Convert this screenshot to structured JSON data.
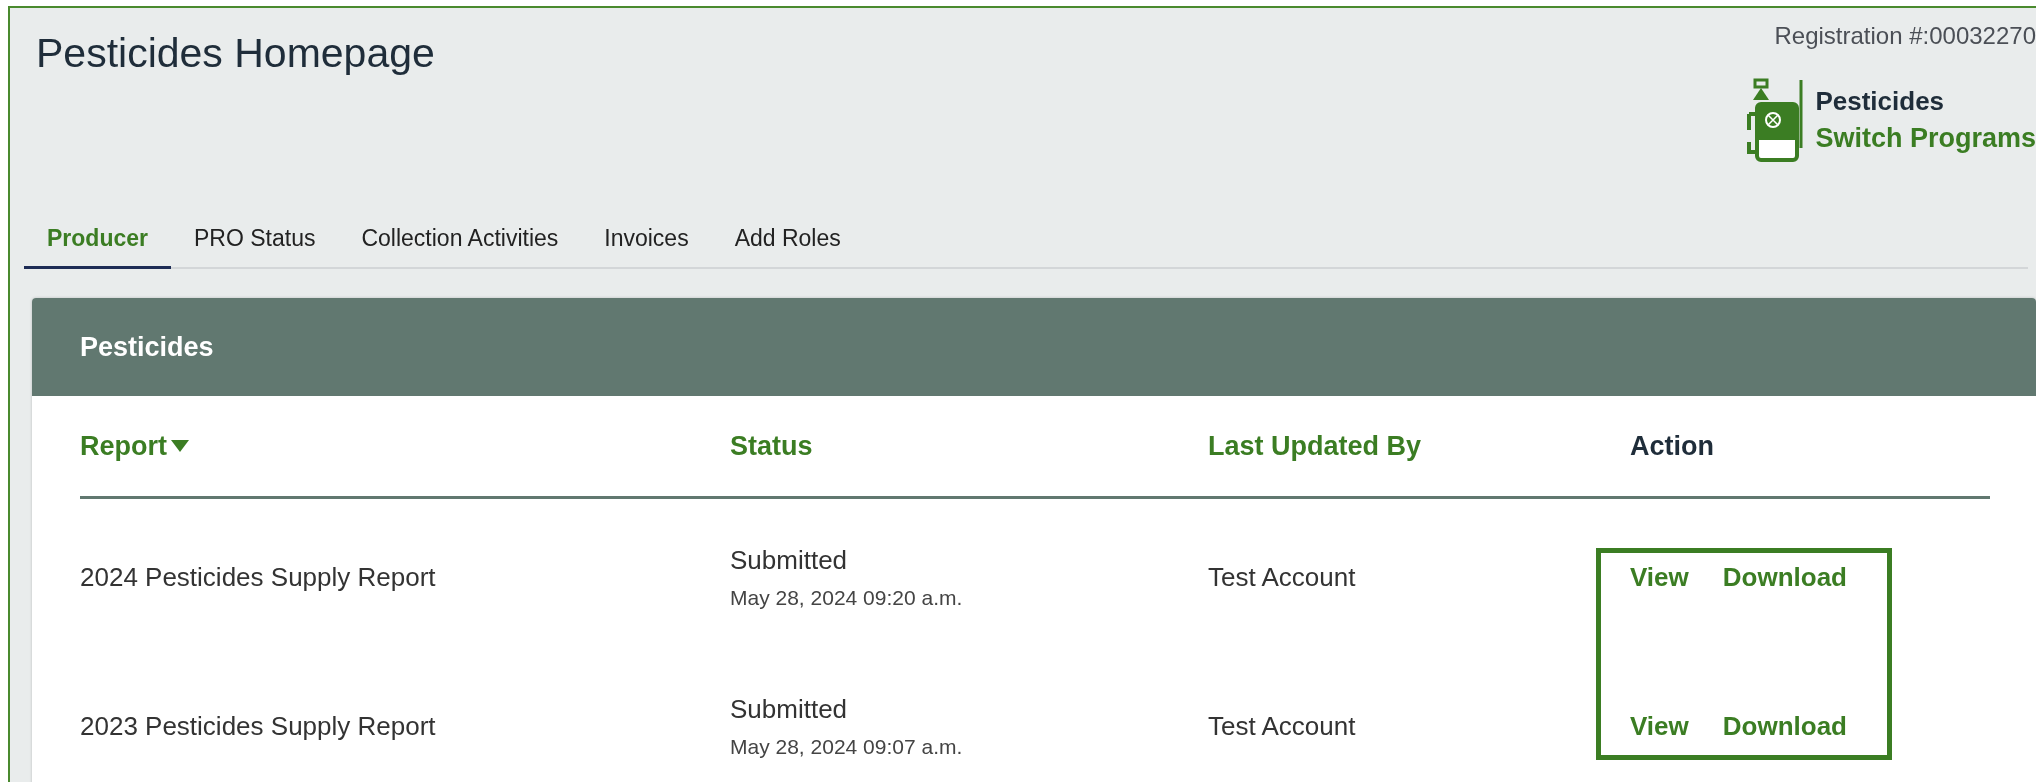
{
  "header": {
    "title": "Pesticides Homepage",
    "registration": "Registration #:00032270",
    "program": {
      "name": "Pesticides",
      "switch_link": "Switch Programs"
    }
  },
  "tabs": [
    {
      "label": "Producer",
      "selected": true
    },
    {
      "label": "PRO Status",
      "selected": false
    },
    {
      "label": "Collection Activities",
      "selected": false
    },
    {
      "label": "Invoices",
      "selected": false
    },
    {
      "label": "Add Roles",
      "selected": false
    }
  ],
  "card": {
    "title": "Pesticides",
    "table": {
      "columns": [
        {
          "label": "Report",
          "sortable": true,
          "sorted": true
        },
        {
          "label": "Status",
          "sortable": true,
          "sorted": false
        },
        {
          "label": "Last Updated By",
          "sortable": true,
          "sorted": false
        },
        {
          "label": "Action",
          "sortable": false,
          "sorted": false
        }
      ],
      "rows": [
        {
          "report": "2024 Pesticides Supply Report",
          "status": "Submitted",
          "date": "May 28, 2024 09:20 a.m.",
          "updated_by": "Test Account",
          "actions": [
            "View",
            "Download"
          ]
        },
        {
          "report": "2023 Pesticides Supply Report",
          "status": "Submitted",
          "date": "May 28, 2024 09:07 a.m.",
          "updated_by": "Test Account",
          "actions": [
            "View",
            "Download"
          ]
        }
      ]
    }
  }
}
